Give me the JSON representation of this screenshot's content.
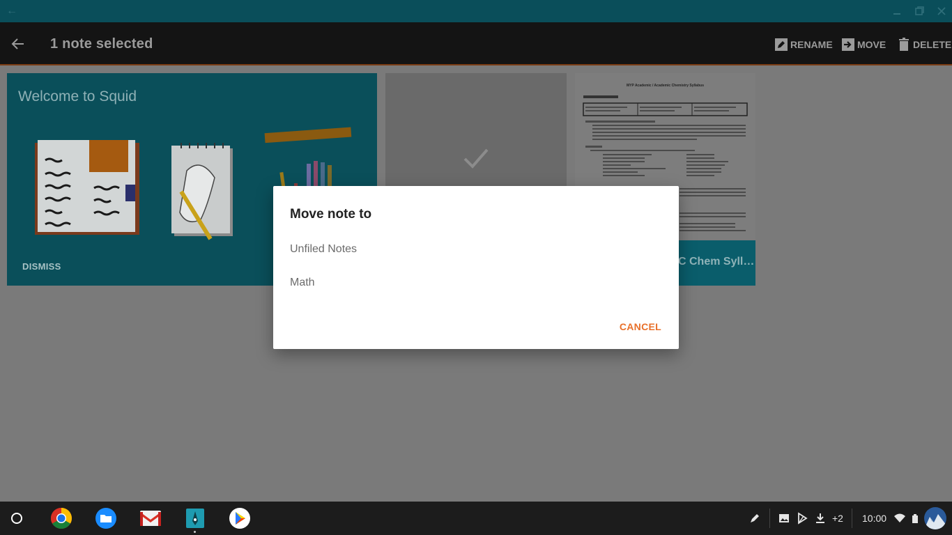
{
  "appbar": {
    "title": "1 note selected",
    "rename_label": "RENAME",
    "move_label": "MOVE",
    "delete_label": "DELETE"
  },
  "cards": {
    "welcome": {
      "title": "Welcome to Squid",
      "dismiss_label": "DISMISS"
    },
    "doc": {
      "name": "C Chem Syll…",
      "page_heading": "MYP Academic / Academic Chemistry Syllabus"
    }
  },
  "dialog": {
    "title": "Move note to",
    "options": [
      "Unfiled Notes",
      "Math"
    ],
    "cancel_label": "CANCEL"
  },
  "shelf": {
    "notification_count": "+2",
    "time": "10:00"
  },
  "colors": {
    "accent": "#e8702a",
    "teal": "#0a4f5a",
    "appbar": "#141414"
  }
}
